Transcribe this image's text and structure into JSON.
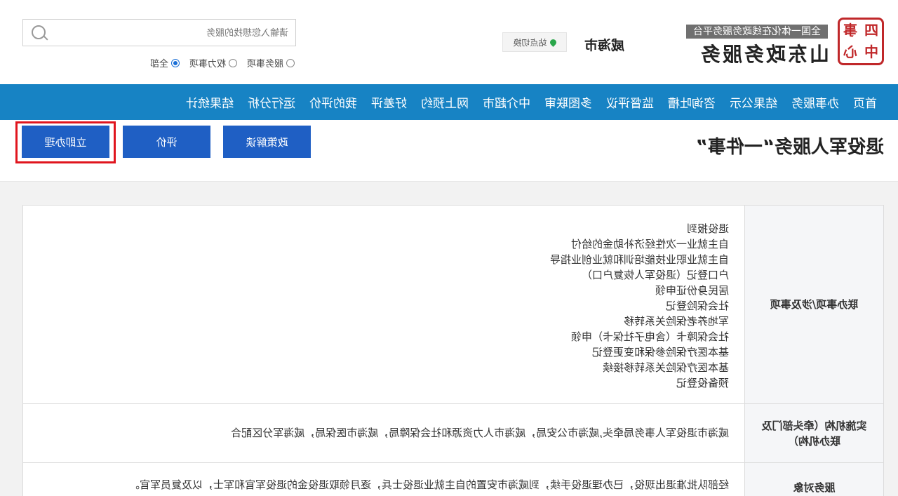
{
  "header": {
    "seal_chars": [
      "四",
      "事",
      "中",
      "心"
    ],
    "brand_tag": "全国一体化在线政务服务平台",
    "brand_title": "山东政务服务",
    "city": "威海市",
    "switch_site": "站点切换",
    "search_placeholder": "请输入您想找的服务",
    "radios": [
      {
        "label": "全部",
        "selected": true
      },
      {
        "label": "权力事项",
        "selected": false
      },
      {
        "label": "服务事项",
        "selected": false
      }
    ]
  },
  "nav": {
    "items": [
      "首页",
      "办事服务",
      "结果公示",
      "咨询吐槽",
      "监督评议",
      "多图联审",
      "中介超市",
      "网上预约",
      "好差评",
      "我的评价",
      "运行分析",
      "结果统计"
    ]
  },
  "subbar": {
    "title": "退役军人服务“一件事”",
    "policy_btn": "政策解读",
    "eval_btn": "评价",
    "apply_btn": "立即办理"
  },
  "table": {
    "rows": [
      {
        "label": "联办事项/涉及事项",
        "items": [
          "退役报到",
          "自主就业一次性经济补助金的给付",
          "自主就业职业技能培训和就业创业指导",
          "户口登记（退役军人恢复户口）",
          "居民身份证申领",
          "社会保险登记",
          "军地养老保险关系转移",
          "社会保障卡（含电子社保卡）申领",
          "基本医疗保险参保和变更登记",
          "基本医疗保险关系转移接续",
          "预备役登记"
        ]
      },
      {
        "label": "实施机构（牵头部门及联办机构）",
        "content": "威海市退役军人事务局牵头,威海市公安局，威海市人力资源和社会保障局，威海市医保局，威海军分区配合"
      },
      {
        "label": "服务对象",
        "content": "经部队批准退出现役，已办理退役手续，到威海市安置的自主就业退役士兵，逐月领取退役金的退役军官和军士，以及复员军官。"
      }
    ]
  }
}
